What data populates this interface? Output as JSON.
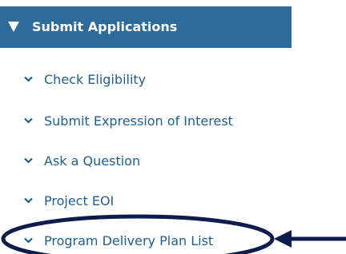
{
  "menu": {
    "header": {
      "label": "Submit Applications",
      "icon": "caret-down-icon",
      "color": "#2e6b9d"
    },
    "items": [
      {
        "label": "Check Eligibility",
        "icon": "chevron-down-icon"
      },
      {
        "label": "Submit Expression of Interest",
        "icon": "chevron-down-icon"
      },
      {
        "label": "Ask a Question",
        "icon": "chevron-down-icon"
      },
      {
        "label": "Project EOI",
        "icon": "chevron-down-icon"
      },
      {
        "label": "Program Delivery Plan List",
        "icon": "chevron-down-icon"
      }
    ]
  },
  "annotation": {
    "highlight_color": "#0d1b4d",
    "highlighted_item": "Program Delivery Plan List"
  }
}
